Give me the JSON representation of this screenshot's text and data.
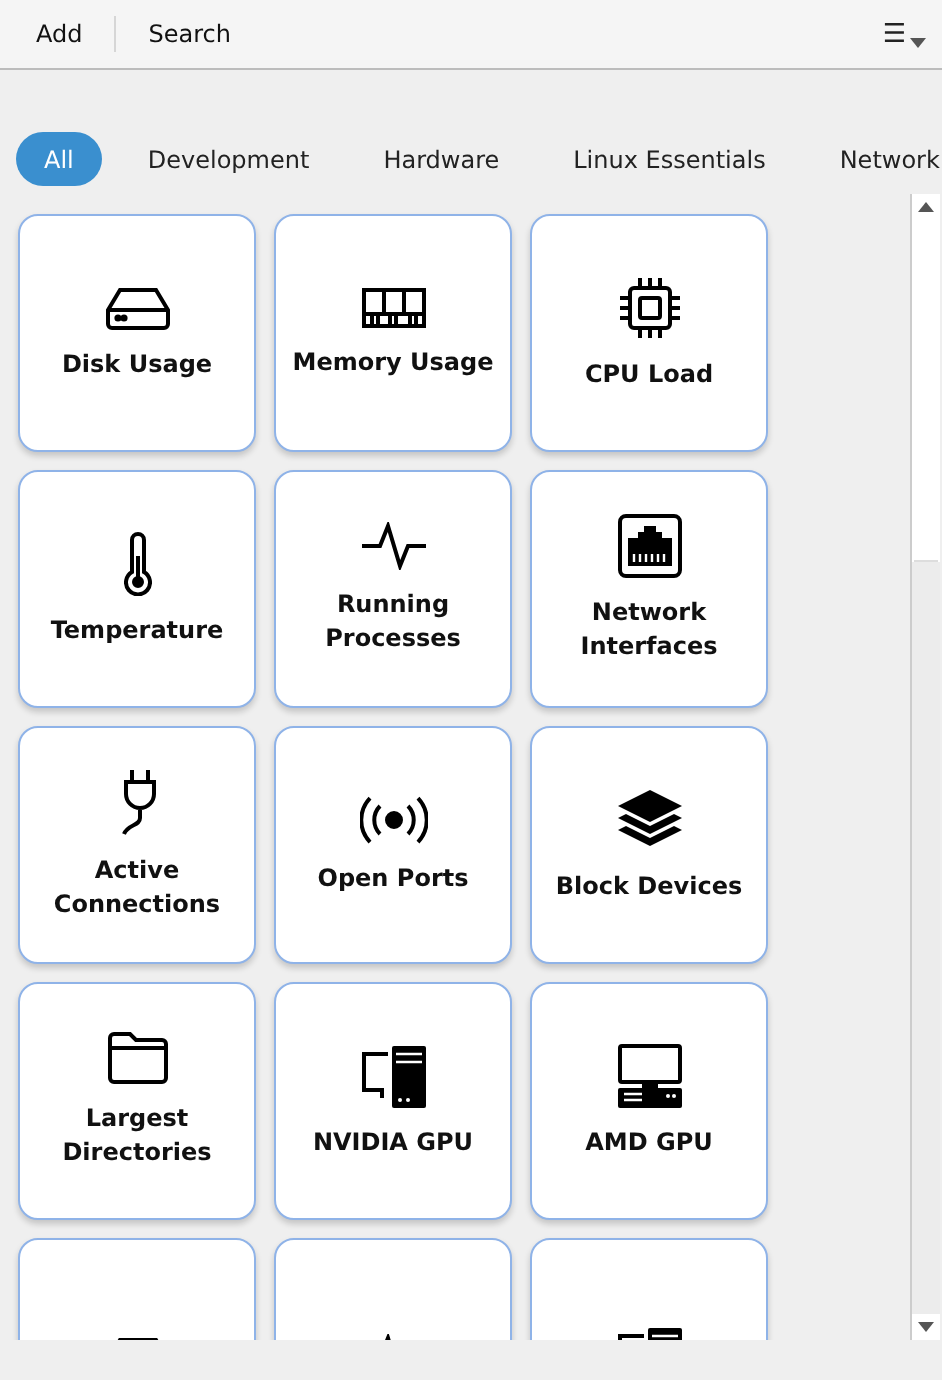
{
  "toolbar": {
    "buttons": [
      "Add",
      "Search"
    ],
    "menu_icon": "☰"
  },
  "tabs": [
    {
      "label": "All",
      "selected": true
    },
    {
      "label": "Development",
      "selected": false
    },
    {
      "label": "Hardware",
      "selected": false
    },
    {
      "label": "Linux Essentials",
      "selected": false
    },
    {
      "label": "Network",
      "selected": false
    }
  ],
  "cards": [
    {
      "kind": "disk",
      "label": "Disk Usage"
    },
    {
      "kind": "memory",
      "label": "Memory Usage"
    },
    {
      "kind": "cpu",
      "label": "CPU Load"
    },
    {
      "kind": "thermometer",
      "label": "Temperature"
    },
    {
      "kind": "pulse",
      "label": "Running Processes"
    },
    {
      "kind": "ethernet",
      "label": "Network Interfaces"
    },
    {
      "kind": "plug",
      "label": "Active Connections"
    },
    {
      "kind": "broadcast",
      "label": "Open Ports"
    },
    {
      "kind": "layers",
      "label": "Block Devices"
    },
    {
      "kind": "folder",
      "label": "Largest Directories"
    },
    {
      "kind": "tower",
      "label": "NVIDIA GPU"
    },
    {
      "kind": "desktop",
      "label": "AMD GPU"
    },
    {
      "kind": "disk"
    },
    {
      "kind": "pulse"
    },
    {
      "kind": "tower"
    }
  ]
}
